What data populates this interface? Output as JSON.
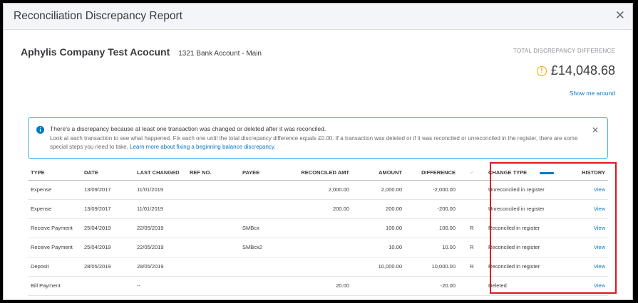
{
  "dialog": {
    "title": "Reconciliation Discrepancy Report",
    "close_icon": "close-icon"
  },
  "header": {
    "company": "Aphylis Company Test Acocunt",
    "account": "1321 Bank Account - Main"
  },
  "discrepancy": {
    "label": "TOTAL DISCREPANCY DIFFERENCE",
    "amount": "£14,048.68",
    "show_link": "Show me around",
    "warning_icon": "warning-icon"
  },
  "banner": {
    "title": "There's a discrepancy because at least one transaction was changed or deleted after it was reconciled.",
    "body": "Look at each transaction to see what happened. Fix each one until the total discrepancy difference equals £0.00. If a transaction was deleted or if it was reconciled or unreconciled in the register, there are some special steps you need to take.",
    "link": "Learn more about fixing a beginning balance discrepancy.",
    "info_icon": "info-icon"
  },
  "table": {
    "columns": [
      "TYPE",
      "DATE",
      "LAST CHANGED",
      "REF NO.",
      "PAYEE",
      "RECONCILED AMT",
      "AMOUNT",
      "DIFFERENCE",
      "✓",
      "CHANGE TYPE",
      "HISTORY"
    ],
    "rows": [
      [
        "Expense",
        "13/09/2017",
        "11/01/2019",
        "",
        "",
        "2,000.00",
        "2,000.00",
        "-2,000.00",
        "",
        "Unreconciled in register",
        "View"
      ],
      [
        "Expense",
        "13/09/2017",
        "11/01/2019",
        "",
        "",
        "200.00",
        "200.00",
        "-200.00",
        "",
        "Unreconciled in register",
        "View"
      ],
      [
        "Receive Payment",
        "25/04/2019",
        "22/05/2019",
        "",
        "SMBcx",
        "",
        "100.00",
        "100.00",
        "R",
        "Reconciled in register",
        "View"
      ],
      [
        "Receive Payment",
        "25/04/2019",
        "22/05/2019",
        "",
        "SMBcx2",
        "",
        "10.00",
        "10.00",
        "R",
        "Reconciled in register",
        "View"
      ],
      [
        "Deposit",
        "28/05/2019",
        "28/05/2019",
        "",
        "",
        "",
        "10,000.00",
        "10,000.00",
        "R",
        "Reconciled in register",
        "View"
      ],
      [
        "Bill Payment",
        "",
        "--",
        "",
        "",
        "20.00",
        "",
        "-20.00",
        "",
        "Deleted",
        "View"
      ]
    ]
  },
  "colors": {
    "link": "#0077c5",
    "highlight": "#e0141e",
    "warning": "#f2a500",
    "info_border": "#38b6e8"
  }
}
